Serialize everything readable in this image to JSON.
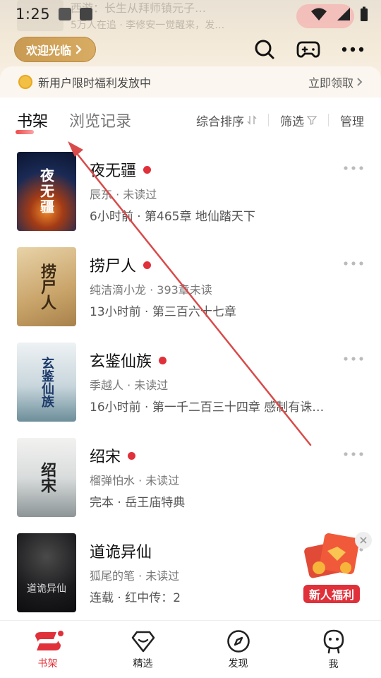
{
  "status_bar": {
    "time": "1:25"
  },
  "promo_banner": {
    "line1": "西游：长生从拜师镇元子…",
    "line2": "5万人在追 · 李修安一觉醒来，发…"
  },
  "header": {
    "welcome_label": "欢迎光临",
    "icons": [
      "search-icon",
      "gamepad-icon",
      "more-icon"
    ]
  },
  "benefit_bar": {
    "text": "新用户限时福利发放中",
    "link": "立即领取"
  },
  "tabs": {
    "bookshelf": "书架",
    "history": "浏览记录"
  },
  "tools": {
    "sort": "综合排序",
    "filter": "筛选",
    "manage": "管理"
  },
  "books": [
    {
      "title": "夜无疆",
      "meta": "辰东 · 未读过",
      "progress": "6小时前 · 第465章 地仙踏天下",
      "has_update": true,
      "cover_text": "夜无疆"
    },
    {
      "title": "捞尸人",
      "meta": "纯洁滴小龙 · 393章未读",
      "progress": "13小时前 · 第三百六十七章",
      "has_update": true,
      "cover_text": "捞尸人"
    },
    {
      "title": "玄鉴仙族",
      "meta": "季越人 · 未读过",
      "progress": "16小时前 · 第一千二百三十四章 感制有诛…",
      "has_update": true,
      "cover_text": "玄鉴仙族"
    },
    {
      "title": "绍宋",
      "meta": "榴弹怕水 · 未读过",
      "progress": "完本 · 岳王庙特典",
      "has_update": true,
      "cover_text": "绍宋"
    },
    {
      "title": "道诡异仙",
      "meta": "狐尾的笔 · 未读过",
      "progress": "连载 · 红中传：2",
      "has_update": false,
      "cover_text": "道诡异仙"
    }
  ],
  "float_badge": {
    "label": "新人福利"
  },
  "bottom_nav": [
    {
      "label": "书架",
      "icon": "bookshelf-icon",
      "active": true
    },
    {
      "label": "精选",
      "icon": "diamond-icon",
      "active": false
    },
    {
      "label": "发现",
      "icon": "compass-icon",
      "active": false
    },
    {
      "label": "我",
      "icon": "profile-icon",
      "active": false
    }
  ],
  "colors": {
    "accent": "#e0303a",
    "gold": "#c99a52"
  }
}
